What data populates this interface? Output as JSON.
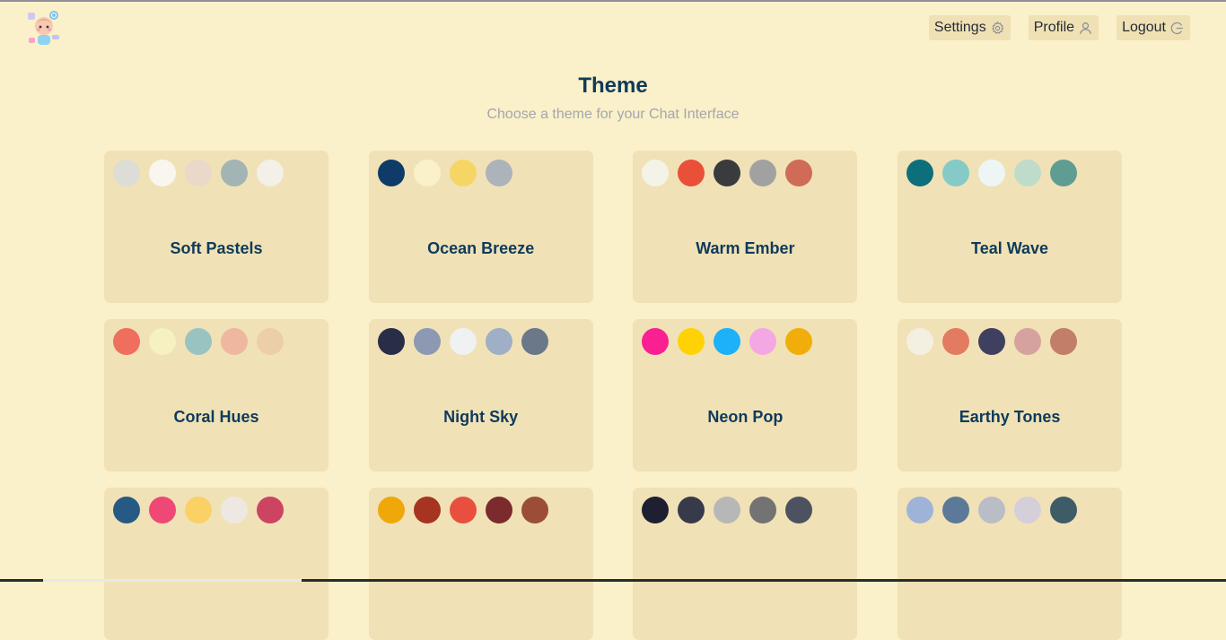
{
  "header": {
    "nav": [
      {
        "label": "Settings",
        "icon": "gear-icon"
      },
      {
        "label": "Profile",
        "icon": "user-icon"
      },
      {
        "label": "Logout",
        "icon": "logout-icon"
      }
    ]
  },
  "page": {
    "title": "Theme",
    "subtitle": "Choose a theme for your Chat Interface"
  },
  "themes": [
    {
      "name": "Soft Pastels",
      "colors": [
        "#dcddd7",
        "#f9f6ef",
        "#ead9c8",
        "#a2b4b4",
        "#f3f0e7"
      ]
    },
    {
      "name": "Ocean Breeze",
      "colors": [
        "#0e3b67",
        "#faf0c9",
        "#f5d564",
        "#adb3ba"
      ]
    },
    {
      "name": "Warm Ember",
      "colors": [
        "#f4f3e8",
        "#ea4f3a",
        "#393b3d",
        "#a2a1a1",
        "#d06b57"
      ]
    },
    {
      "name": "Teal Wave",
      "colors": [
        "#0c6f7b",
        "#85cac6",
        "#eef6f5",
        "#bfdbca",
        "#5f9d92"
      ]
    },
    {
      "name": "Coral Hues",
      "colors": [
        "#ef6e5d",
        "#f5f1c0",
        "#99c3c1",
        "#efb7a0",
        "#eccfa9"
      ]
    },
    {
      "name": "Night Sky",
      "colors": [
        "#2a2d48",
        "#8d98b3",
        "#eff1f3",
        "#9fafc5",
        "#6b7889"
      ]
    },
    {
      "name": "Neon Pop",
      "colors": [
        "#fa2092",
        "#fed204",
        "#1db1f9",
        "#f3a8e3",
        "#f1ae0a"
      ]
    },
    {
      "name": "Earthy Tones",
      "colors": [
        "#f3f0e2",
        "#e27b5f",
        "#3f405f",
        "#d6a29f",
        "#c27e69"
      ]
    },
    {
      "name": "",
      "colors": [
        "#265a84",
        "#ef4876",
        "#fbd065",
        "#ede9e2",
        "#cc4462"
      ]
    },
    {
      "name": "",
      "colors": [
        "#f0a708",
        "#a63421",
        "#e94f3e",
        "#7b2a2e",
        "#9c4d38"
      ]
    },
    {
      "name": "",
      "colors": [
        "#1e2032",
        "#373a4a",
        "#b7b7b7",
        "#737373",
        "#4c525f"
      ]
    },
    {
      "name": "",
      "colors": [
        "#9fb3d7",
        "#5c7a98",
        "#babcc6",
        "#d5cfd9",
        "#3e5b68"
      ]
    }
  ]
}
